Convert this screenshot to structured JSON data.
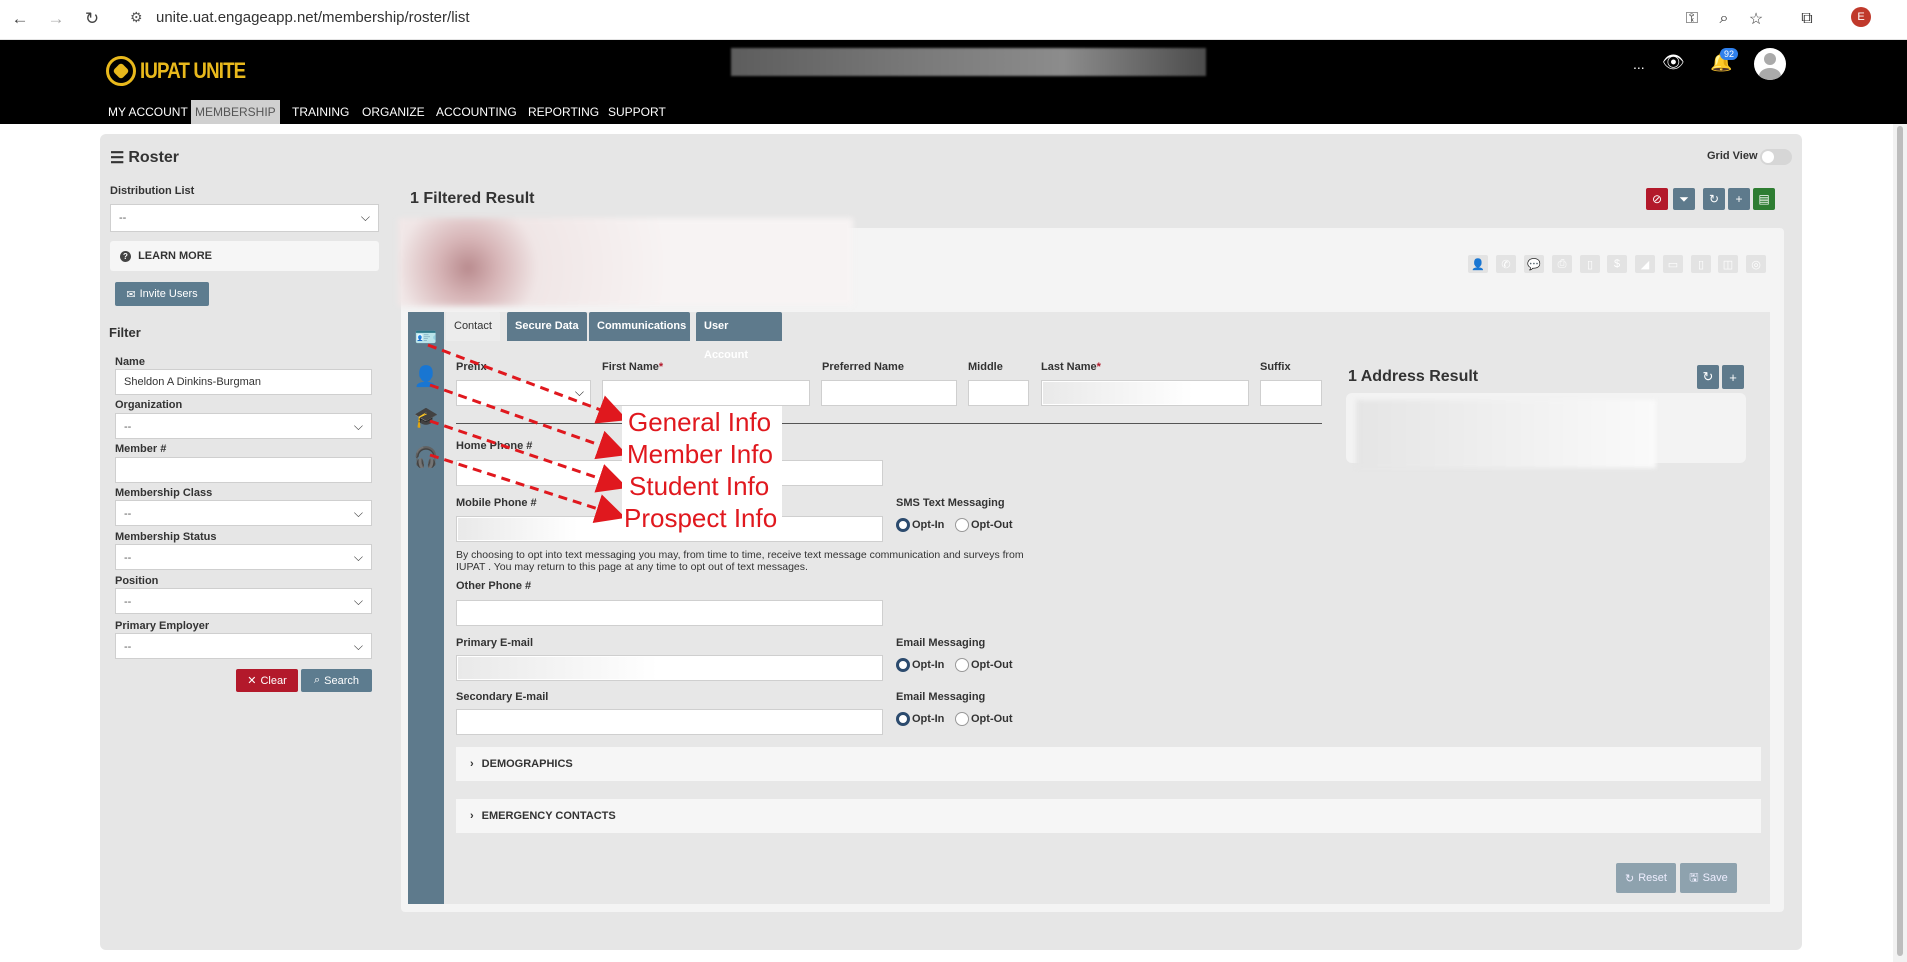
{
  "browser": {
    "url": "unite.uat.engageapp.net/membership/roster/list",
    "profile_initial": "E"
  },
  "app": {
    "logo_text": "IUPAT UNITE",
    "more_label": "...",
    "notifications_count": "92"
  },
  "menu": [
    "MY ACCOUNT",
    "MEMBERSHIP",
    "TRAINING",
    "ORGANIZE",
    "ACCOUNTING",
    "REPORTING",
    "SUPPORT"
  ],
  "sidebar": {
    "title": "Roster",
    "distribution_label": "Distribution List",
    "distribution_value": "--",
    "learn_more": "LEARN MORE",
    "invite_users": "Invite Users",
    "filter_heading": "Filter",
    "name_label": "Name",
    "name_value": "Sheldon A Dinkins-Burgman",
    "organization_label": "Organization",
    "organization_value": "--",
    "member_label": "Member #",
    "member_value": "",
    "class_label": "Membership Class",
    "class_value": "--",
    "status_label": "Membership Status",
    "status_value": "--",
    "position_label": "Position",
    "position_value": "--",
    "employer_label": "Primary Employer",
    "employer_value": "--",
    "clear_label": "Clear",
    "search_label": "Search"
  },
  "main": {
    "results_title": "1 Filtered Result",
    "grid_view_label": "Grid View",
    "toolbar_colors": {
      "clear_filter": "#b3192b",
      "filter": "#5e7a8c",
      "refresh": "#5e7a8c",
      "add": "#5e7a8c",
      "export": "#2e7d32"
    }
  },
  "tabs": [
    "Contact",
    "Secure Data",
    "Communications",
    "User Account"
  ],
  "form": {
    "prefix_label": "Prefix",
    "first_name_label": "First Name",
    "preferred_name_label": "Preferred Name",
    "middle_label": "Middle",
    "last_name_label": "Last Name",
    "suffix_label": "Suffix",
    "required_mark": "*",
    "home_phone_label": "Home Phone #",
    "mobile_phone_label": "Mobile Phone #",
    "sms_label": "SMS Text Messaging",
    "opt_in": "Opt-In",
    "opt_out": "Opt-Out",
    "sms_note": "By choosing to opt into text messaging you may, from time to time, receive text message communication and surveys from IUPAT . You may return to this page at any time to opt out of text messages.",
    "other_phone_label": "Other Phone #",
    "primary_email_label": "Primary E-mail",
    "secondary_email_label": "Secondary E-mail",
    "email_messaging_label": "Email Messaging",
    "demographics": "DEMOGRAPHICS",
    "emergency_contacts": "EMERGENCY CONTACTS",
    "reset_label": "Reset",
    "save_label": "Save"
  },
  "address": {
    "title": "1 Address Result"
  },
  "annotations": [
    "General Info",
    "Member Info",
    "Student Info",
    "Prospect Info"
  ]
}
